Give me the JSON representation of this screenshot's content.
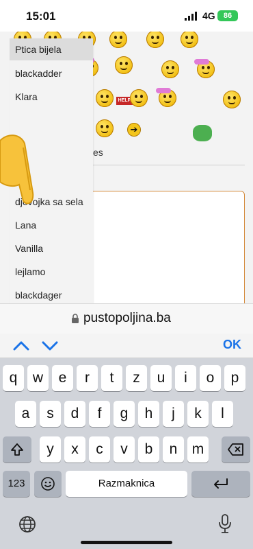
{
  "status_bar": {
    "time": "15:01",
    "network": "4G",
    "battery": "86"
  },
  "page": {
    "label_fragment": "es",
    "dropdown": {
      "options": [
        "Ptica bijela",
        "blackadder",
        "Klara",
        "djevojka sa sela",
        "Lana",
        "Vanilla",
        "lejlamo",
        "blackdager"
      ],
      "selected_index": 0
    }
  },
  "address_bar": {
    "url": "pustopoljina.ba"
  },
  "accessory_bar": {
    "ok_label": "OK"
  },
  "keyboard": {
    "row1": [
      "q",
      "w",
      "e",
      "r",
      "t",
      "z",
      "u",
      "i",
      "o",
      "p"
    ],
    "row2": [
      "a",
      "s",
      "d",
      "f",
      "g",
      "h",
      "j",
      "k",
      "l"
    ],
    "row3": [
      "y",
      "x",
      "c",
      "v",
      "b",
      "n",
      "m"
    ],
    "numbers_label": "123",
    "space_label": "Razmaknica"
  },
  "icons": {
    "emoji_sign_text": "HELP",
    "arrow_glyph": "➔"
  },
  "colors": {
    "accent": "#1a73e8",
    "battery": "#34c759",
    "textarea_border": "#d48a3a"
  }
}
